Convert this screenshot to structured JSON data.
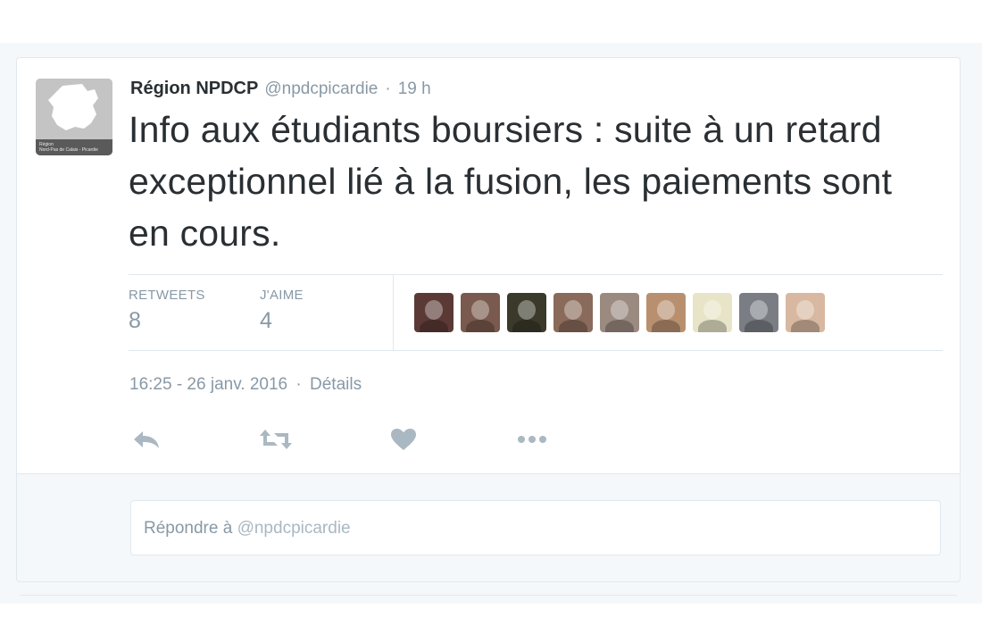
{
  "tweet": {
    "display_name": "Région NPDCP",
    "handle": "@npdcpicardie",
    "separator": "·",
    "time_ago": "19 h",
    "text": "Info aux étudiants boursiers : suite à un retard exceptionnel lié à la fusion, les paiements sont en cours.",
    "avatar": {
      "caption_line1": "Région",
      "caption_line2": "Nord-Pas de Calais - Picardie"
    }
  },
  "stats": {
    "retweets_label": "RETWEETS",
    "retweets_count": "8",
    "likes_label": "J'AIME",
    "likes_count": "4"
  },
  "likers": [
    {
      "name": "liker-1",
      "color": "#5b3a36"
    },
    {
      "name": "liker-2",
      "color": "#7a5a4e"
    },
    {
      "name": "liker-3",
      "color": "#3b3a2a"
    },
    {
      "name": "liker-4",
      "color": "#8a6a5a"
    },
    {
      "name": "liker-5",
      "color": "#9a8a80"
    },
    {
      "name": "liker-6",
      "color": "#b89070"
    },
    {
      "name": "liker-7",
      "color": "#e8e4c8"
    },
    {
      "name": "liker-8",
      "color": "#7a7e84"
    },
    {
      "name": "liker-9",
      "color": "#d8b8a0"
    }
  ],
  "timestamp": {
    "datetime": "16:25 - 26 janv. 2016",
    "separator": "·",
    "details_link": "Détails"
  },
  "actions": {
    "reply_icon": "reply-icon",
    "retweet_icon": "retweet-icon",
    "like_icon": "heart-icon",
    "more_icon": "more-icon",
    "icon_color": "#aab8c2"
  },
  "reply": {
    "prefix": "Répondre à",
    "handle": "@npdcpicardie"
  }
}
